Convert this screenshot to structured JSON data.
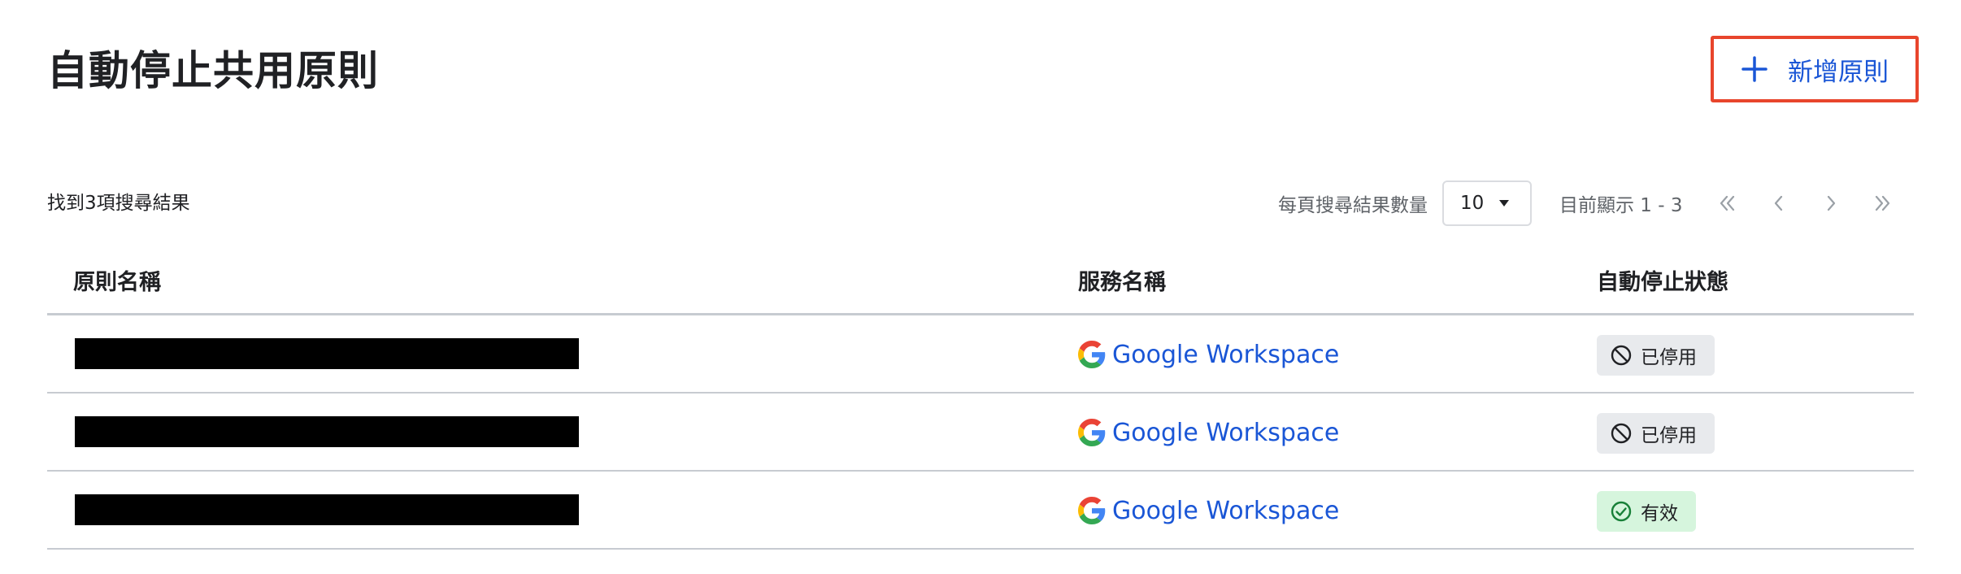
{
  "header": {
    "title": "自動停止共用原則",
    "add_button_label": "新增原則"
  },
  "toolbar": {
    "results_count": "找到3項搜尋結果",
    "per_page_label": "每頁搜尋結果數量",
    "per_page_value": "10",
    "range_label": "目前顯示 1 - 3"
  },
  "table": {
    "columns": [
      "原則名稱",
      "服務名稱",
      "自動停止狀態"
    ],
    "rows": [
      {
        "service": "Google Workspace",
        "status": "已停用",
        "status_type": "disabled"
      },
      {
        "service": "Google Workspace",
        "status": "已停用",
        "status_type": "disabled"
      },
      {
        "service": "Google Workspace",
        "status": "有效",
        "status_type": "active"
      }
    ]
  },
  "colors": {
    "accent": "#1a56d6",
    "highlight_border": "#e8452c",
    "disabled_badge_bg": "#e8eaed",
    "active_badge_bg": "#d6f5dd",
    "active_icon": "#188038"
  },
  "icons": {
    "add": "plus-icon",
    "caret": "caret-down-icon",
    "first": "double-chevron-left-icon",
    "prev": "chevron-left-icon",
    "next": "chevron-right-icon",
    "last": "double-chevron-right-icon",
    "service": "google-logo-icon",
    "disabled": "prohibited-icon",
    "active": "check-circle-icon"
  }
}
